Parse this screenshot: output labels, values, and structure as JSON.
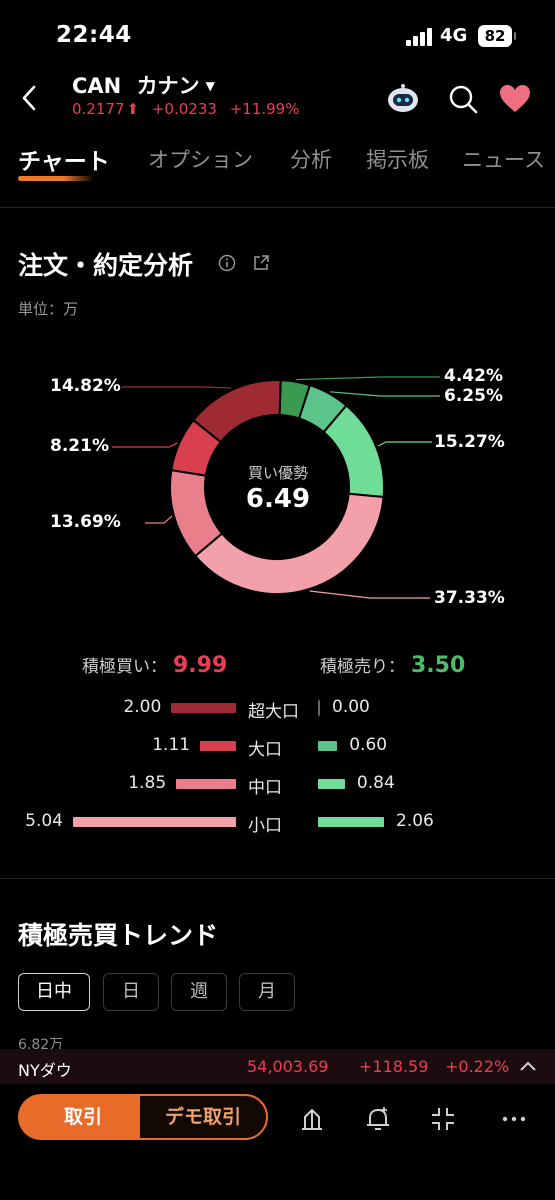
{
  "status": {
    "time": "22:44",
    "network": "4G",
    "battery": "82"
  },
  "header": {
    "ticker": "CAN",
    "name": "カナン",
    "price": "0.2177",
    "change": "+0.0233",
    "change_pct": "+11.99%"
  },
  "tabs": [
    "チャート",
    "オプション",
    "分析",
    "掲示板",
    "ニュース"
  ],
  "analysis": {
    "title": "注文・約定分析",
    "unit": "単位：万",
    "center_label": "買い優勢",
    "center_value": "6.49",
    "pct_labels": {
      "buy_super": "14.82%",
      "buy_large": "8.21%",
      "buy_medium": "13.69%",
      "buy_small": "37.33%",
      "sell_super": "4.42%",
      "sell_large": "6.25%",
      "sell_medium": "15.27%"
    },
    "slices_pct": [
      4.42,
      6.25,
      15.27,
      37.33,
      13.69,
      8.21,
      14.82
    ],
    "totals": {
      "buy_label": "積極買い：",
      "buy_value": "9.99",
      "sell_label": "積極売り：",
      "sell_value": "3.50"
    },
    "rows": [
      {
        "label": "超大口",
        "buy": "2.00",
        "sell": "0.00",
        "buy_num": 2.0,
        "sell_num": 0.0
      },
      {
        "label": "大口",
        "buy": "1.11",
        "sell": "0.60",
        "buy_num": 1.11,
        "sell_num": 0.6
      },
      {
        "label": "中口",
        "buy": "1.85",
        "sell": "0.84",
        "buy_num": 1.85,
        "sell_num": 0.84
      },
      {
        "label": "小口",
        "buy": "5.04",
        "sell": "2.06",
        "buy_num": 5.04,
        "sell_num": 2.06
      }
    ]
  },
  "trend": {
    "title": "積極売買トレンド",
    "tabs": [
      "日中",
      "日",
      "週",
      "月"
    ],
    "axis_top": "6.82万"
  },
  "index": {
    "name": "NYダウ",
    "value": "54,003.69",
    "change": "+118.59",
    "change_pct": "+0.22%"
  },
  "bottom": {
    "trade_label": "取引",
    "demo_label": "デモ取引"
  },
  "colors": {
    "buy_super": "#9e2a33",
    "buy_large": "#d8404f",
    "buy_medium": "#ea7f8c",
    "buy_small": "#f2a0aa",
    "sell_super": "#3a9a52",
    "sell_large": "#5bc48a",
    "sell_medium": "#6fdc98",
    "sell_small": "#6fdc98",
    "up": "#ea3e52",
    "accent": "#e96b2a"
  }
}
